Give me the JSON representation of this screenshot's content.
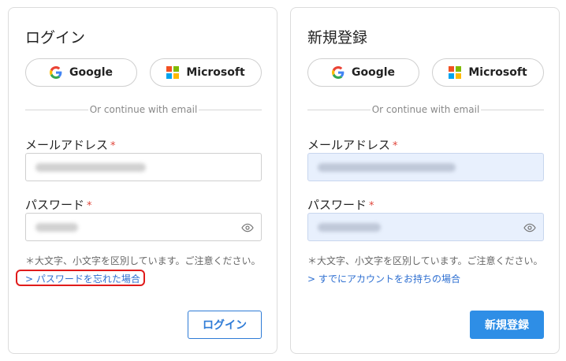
{
  "login": {
    "title": "ログイン",
    "google_label": "Google",
    "microsoft_label": "Microsoft",
    "divider_text": "Or continue with email",
    "email_label": "メールアドレス",
    "required_mark": "*",
    "password_label": "パスワード",
    "case_note": "＊大文字、小文字を区別しています。ご注意ください。",
    "forgot_link": "> パスワードを忘れた場合",
    "submit_label": "ログイン"
  },
  "signup": {
    "title": "新規登録",
    "google_label": "Google",
    "microsoft_label": "Microsoft",
    "divider_text": "Or continue with email",
    "email_label": "メールアドレス",
    "required_mark": "*",
    "password_label": "パスワード",
    "case_note": "＊大文字、小文字を区別しています。ご注意ください。",
    "existing_link": "> すでにアカウントをお持ちの場合",
    "submit_label": "新規登録"
  },
  "colors": {
    "accent": "#2e8ee6",
    "link": "#2e6fd1",
    "required": "#e0463b",
    "highlight": "#e01b1b",
    "autofill_bg": "#e8f0fd"
  },
  "icons": {
    "google": "google-logo-icon",
    "microsoft": "microsoft-logo-icon",
    "password_toggle": "eye-icon"
  }
}
